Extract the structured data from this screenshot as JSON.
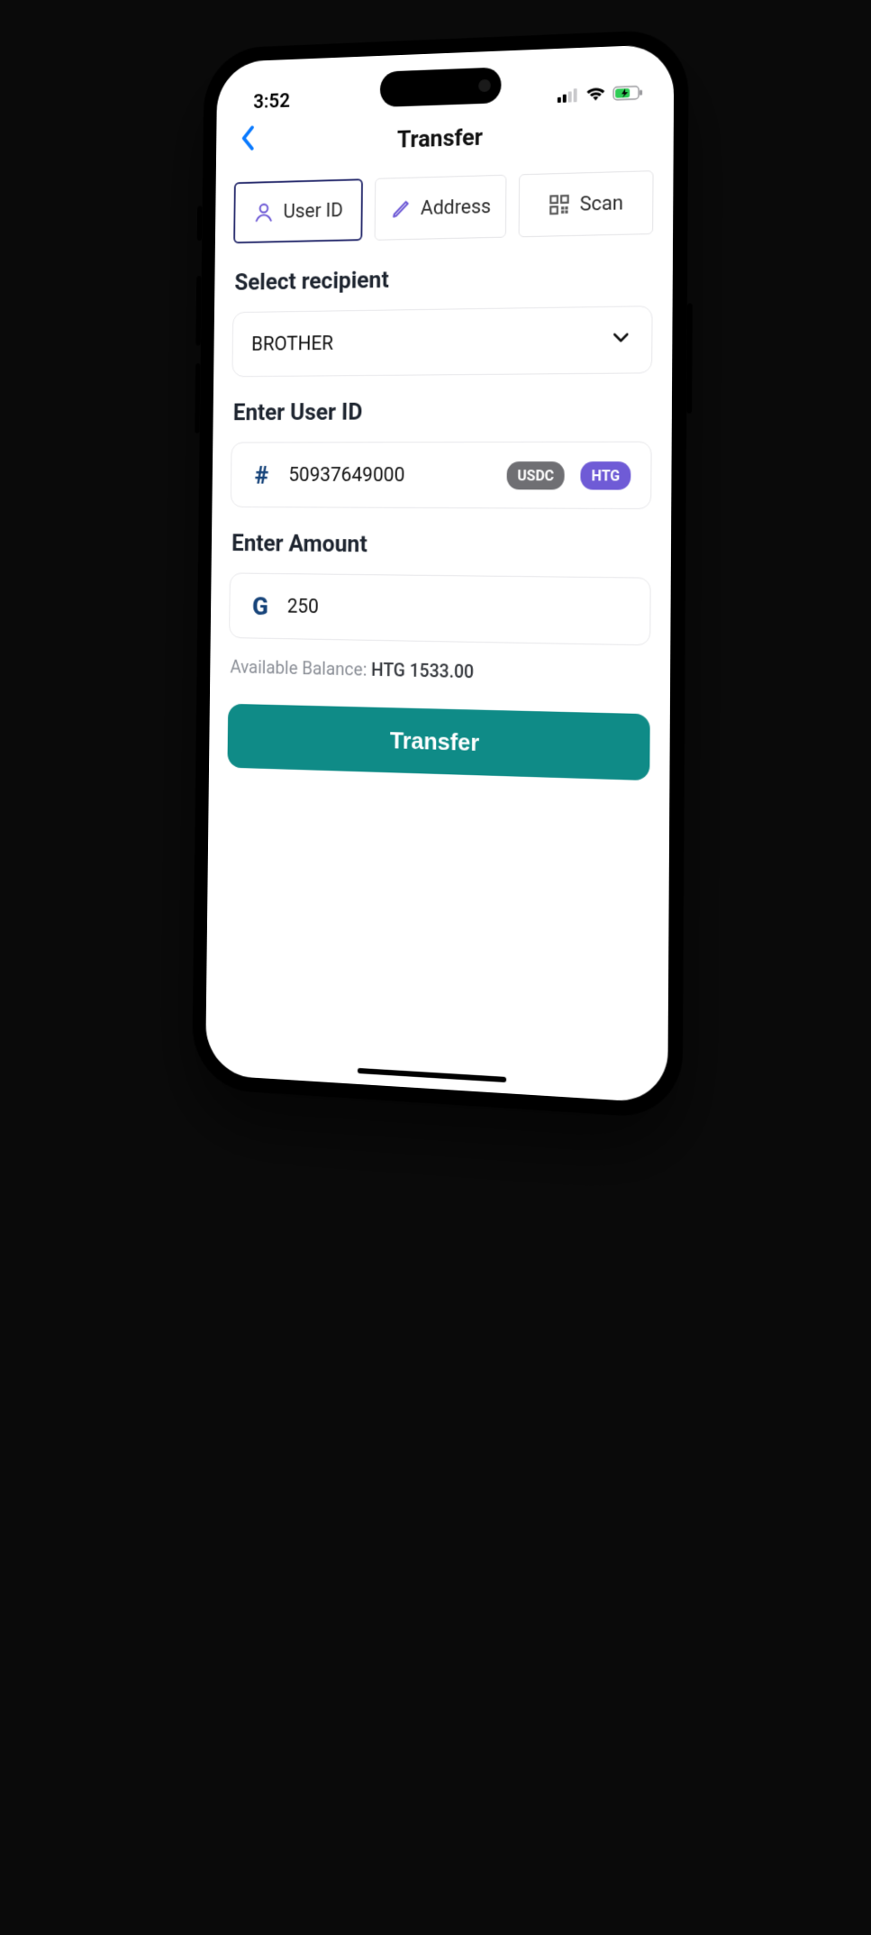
{
  "status": {
    "time": "3:52"
  },
  "header": {
    "title": "Transfer"
  },
  "tabs": {
    "user_id": "User ID",
    "address": "Address",
    "scan": "Scan"
  },
  "labels": {
    "select_recipient": "Select recipient",
    "enter_user_id": "Enter User ID",
    "enter_amount": "Enter Amount",
    "available_balance": "Available Balance:"
  },
  "recipient": {
    "selected": "BROTHER"
  },
  "user_id_field": {
    "value": "50937649000",
    "currency_options": {
      "usdc": "USDC",
      "htg": "HTG"
    }
  },
  "amount_field": {
    "symbol": "G",
    "value": "250"
  },
  "balance": {
    "text": "HTG 1533.00"
  },
  "buttons": {
    "transfer": "Transfer"
  },
  "colors": {
    "accent_teal": "#0f8b87",
    "accent_purple": "#6f5bd6",
    "tab_active_border": "#2a2e6f",
    "ios_blue": "#0a7aff"
  }
}
